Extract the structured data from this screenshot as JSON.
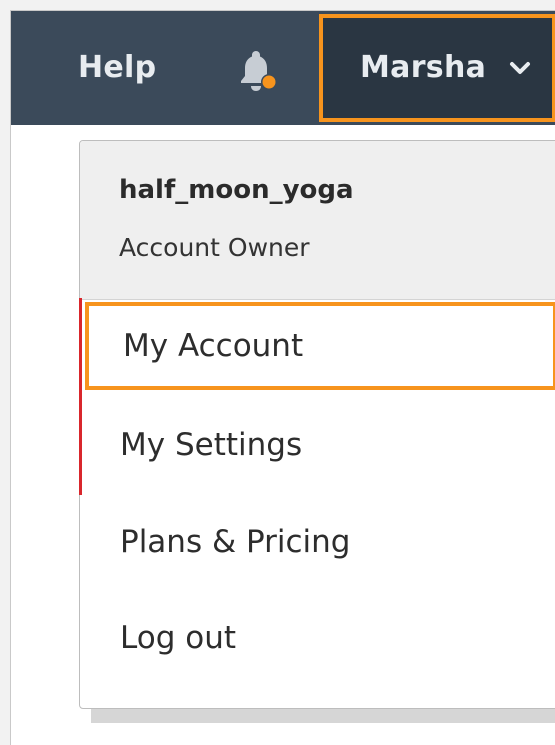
{
  "topbar": {
    "help_label": "Help",
    "notification_icon": "bell-icon",
    "user_label": "Marsha",
    "user_chevron_icon": "chevron-down-icon"
  },
  "dropdown": {
    "account_name": "half_moon_yoga",
    "account_role": "Account Owner",
    "items": [
      {
        "label": "My Account"
      },
      {
        "label": "My Settings"
      },
      {
        "label": "Plans & Pricing"
      },
      {
        "label": "Log out"
      }
    ]
  },
  "colors": {
    "topbar_bg": "#3b4a5a",
    "active_bg": "#2a3642",
    "highlight": "#f7941d",
    "notification_dot": "#f7941d",
    "accent_red": "#d9262c"
  }
}
